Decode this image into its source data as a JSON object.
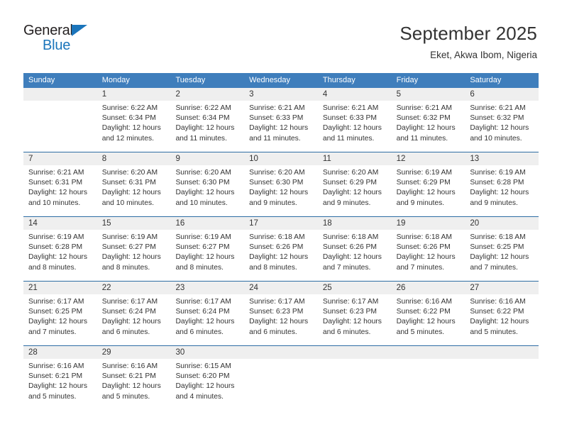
{
  "brand": {
    "name_part1": "General",
    "name_part2": "Blue",
    "triangle_color": "#1b75bb"
  },
  "header": {
    "title": "September 2025",
    "subtitle": "Eket, Akwa Ibom, Nigeria"
  },
  "theme": {
    "header_row_bg": "#3f7ebc",
    "week_separator": "#2e6da4",
    "daynum_band_bg": "#efefef",
    "text_color": "#333333"
  },
  "weekdays": [
    "Sunday",
    "Monday",
    "Tuesday",
    "Wednesday",
    "Thursday",
    "Friday",
    "Saturday"
  ],
  "weeks": [
    [
      {
        "day": "",
        "lines": []
      },
      {
        "day": "1",
        "lines": [
          "Sunrise: 6:22 AM",
          "Sunset: 6:34 PM",
          "Daylight: 12 hours",
          "and 12 minutes."
        ]
      },
      {
        "day": "2",
        "lines": [
          "Sunrise: 6:22 AM",
          "Sunset: 6:34 PM",
          "Daylight: 12 hours",
          "and 11 minutes."
        ]
      },
      {
        "day": "3",
        "lines": [
          "Sunrise: 6:21 AM",
          "Sunset: 6:33 PM",
          "Daylight: 12 hours",
          "and 11 minutes."
        ]
      },
      {
        "day": "4",
        "lines": [
          "Sunrise: 6:21 AM",
          "Sunset: 6:33 PM",
          "Daylight: 12 hours",
          "and 11 minutes."
        ]
      },
      {
        "day": "5",
        "lines": [
          "Sunrise: 6:21 AM",
          "Sunset: 6:32 PM",
          "Daylight: 12 hours",
          "and 11 minutes."
        ]
      },
      {
        "day": "6",
        "lines": [
          "Sunrise: 6:21 AM",
          "Sunset: 6:32 PM",
          "Daylight: 12 hours",
          "and 10 minutes."
        ]
      }
    ],
    [
      {
        "day": "7",
        "lines": [
          "Sunrise: 6:21 AM",
          "Sunset: 6:31 PM",
          "Daylight: 12 hours",
          "and 10 minutes."
        ]
      },
      {
        "day": "8",
        "lines": [
          "Sunrise: 6:20 AM",
          "Sunset: 6:31 PM",
          "Daylight: 12 hours",
          "and 10 minutes."
        ]
      },
      {
        "day": "9",
        "lines": [
          "Sunrise: 6:20 AM",
          "Sunset: 6:30 PM",
          "Daylight: 12 hours",
          "and 10 minutes."
        ]
      },
      {
        "day": "10",
        "lines": [
          "Sunrise: 6:20 AM",
          "Sunset: 6:30 PM",
          "Daylight: 12 hours",
          "and 9 minutes."
        ]
      },
      {
        "day": "11",
        "lines": [
          "Sunrise: 6:20 AM",
          "Sunset: 6:29 PM",
          "Daylight: 12 hours",
          "and 9 minutes."
        ]
      },
      {
        "day": "12",
        "lines": [
          "Sunrise: 6:19 AM",
          "Sunset: 6:29 PM",
          "Daylight: 12 hours",
          "and 9 minutes."
        ]
      },
      {
        "day": "13",
        "lines": [
          "Sunrise: 6:19 AM",
          "Sunset: 6:28 PM",
          "Daylight: 12 hours",
          "and 9 minutes."
        ]
      }
    ],
    [
      {
        "day": "14",
        "lines": [
          "Sunrise: 6:19 AM",
          "Sunset: 6:28 PM",
          "Daylight: 12 hours",
          "and 8 minutes."
        ]
      },
      {
        "day": "15",
        "lines": [
          "Sunrise: 6:19 AM",
          "Sunset: 6:27 PM",
          "Daylight: 12 hours",
          "and 8 minutes."
        ]
      },
      {
        "day": "16",
        "lines": [
          "Sunrise: 6:19 AM",
          "Sunset: 6:27 PM",
          "Daylight: 12 hours",
          "and 8 minutes."
        ]
      },
      {
        "day": "17",
        "lines": [
          "Sunrise: 6:18 AM",
          "Sunset: 6:26 PM",
          "Daylight: 12 hours",
          "and 8 minutes."
        ]
      },
      {
        "day": "18",
        "lines": [
          "Sunrise: 6:18 AM",
          "Sunset: 6:26 PM",
          "Daylight: 12 hours",
          "and 7 minutes."
        ]
      },
      {
        "day": "19",
        "lines": [
          "Sunrise: 6:18 AM",
          "Sunset: 6:26 PM",
          "Daylight: 12 hours",
          "and 7 minutes."
        ]
      },
      {
        "day": "20",
        "lines": [
          "Sunrise: 6:18 AM",
          "Sunset: 6:25 PM",
          "Daylight: 12 hours",
          "and 7 minutes."
        ]
      }
    ],
    [
      {
        "day": "21",
        "lines": [
          "Sunrise: 6:17 AM",
          "Sunset: 6:25 PM",
          "Daylight: 12 hours",
          "and 7 minutes."
        ]
      },
      {
        "day": "22",
        "lines": [
          "Sunrise: 6:17 AM",
          "Sunset: 6:24 PM",
          "Daylight: 12 hours",
          "and 6 minutes."
        ]
      },
      {
        "day": "23",
        "lines": [
          "Sunrise: 6:17 AM",
          "Sunset: 6:24 PM",
          "Daylight: 12 hours",
          "and 6 minutes."
        ]
      },
      {
        "day": "24",
        "lines": [
          "Sunrise: 6:17 AM",
          "Sunset: 6:23 PM",
          "Daylight: 12 hours",
          "and 6 minutes."
        ]
      },
      {
        "day": "25",
        "lines": [
          "Sunrise: 6:17 AM",
          "Sunset: 6:23 PM",
          "Daylight: 12 hours",
          "and 6 minutes."
        ]
      },
      {
        "day": "26",
        "lines": [
          "Sunrise: 6:16 AM",
          "Sunset: 6:22 PM",
          "Daylight: 12 hours",
          "and 5 minutes."
        ]
      },
      {
        "day": "27",
        "lines": [
          "Sunrise: 6:16 AM",
          "Sunset: 6:22 PM",
          "Daylight: 12 hours",
          "and 5 minutes."
        ]
      }
    ],
    [
      {
        "day": "28",
        "lines": [
          "Sunrise: 6:16 AM",
          "Sunset: 6:21 PM",
          "Daylight: 12 hours",
          "and 5 minutes."
        ]
      },
      {
        "day": "29",
        "lines": [
          "Sunrise: 6:16 AM",
          "Sunset: 6:21 PM",
          "Daylight: 12 hours",
          "and 5 minutes."
        ]
      },
      {
        "day": "30",
        "lines": [
          "Sunrise: 6:15 AM",
          "Sunset: 6:20 PM",
          "Daylight: 12 hours",
          "and 4 minutes."
        ]
      },
      {
        "day": "",
        "lines": []
      },
      {
        "day": "",
        "lines": []
      },
      {
        "day": "",
        "lines": []
      },
      {
        "day": "",
        "lines": []
      }
    ]
  ]
}
